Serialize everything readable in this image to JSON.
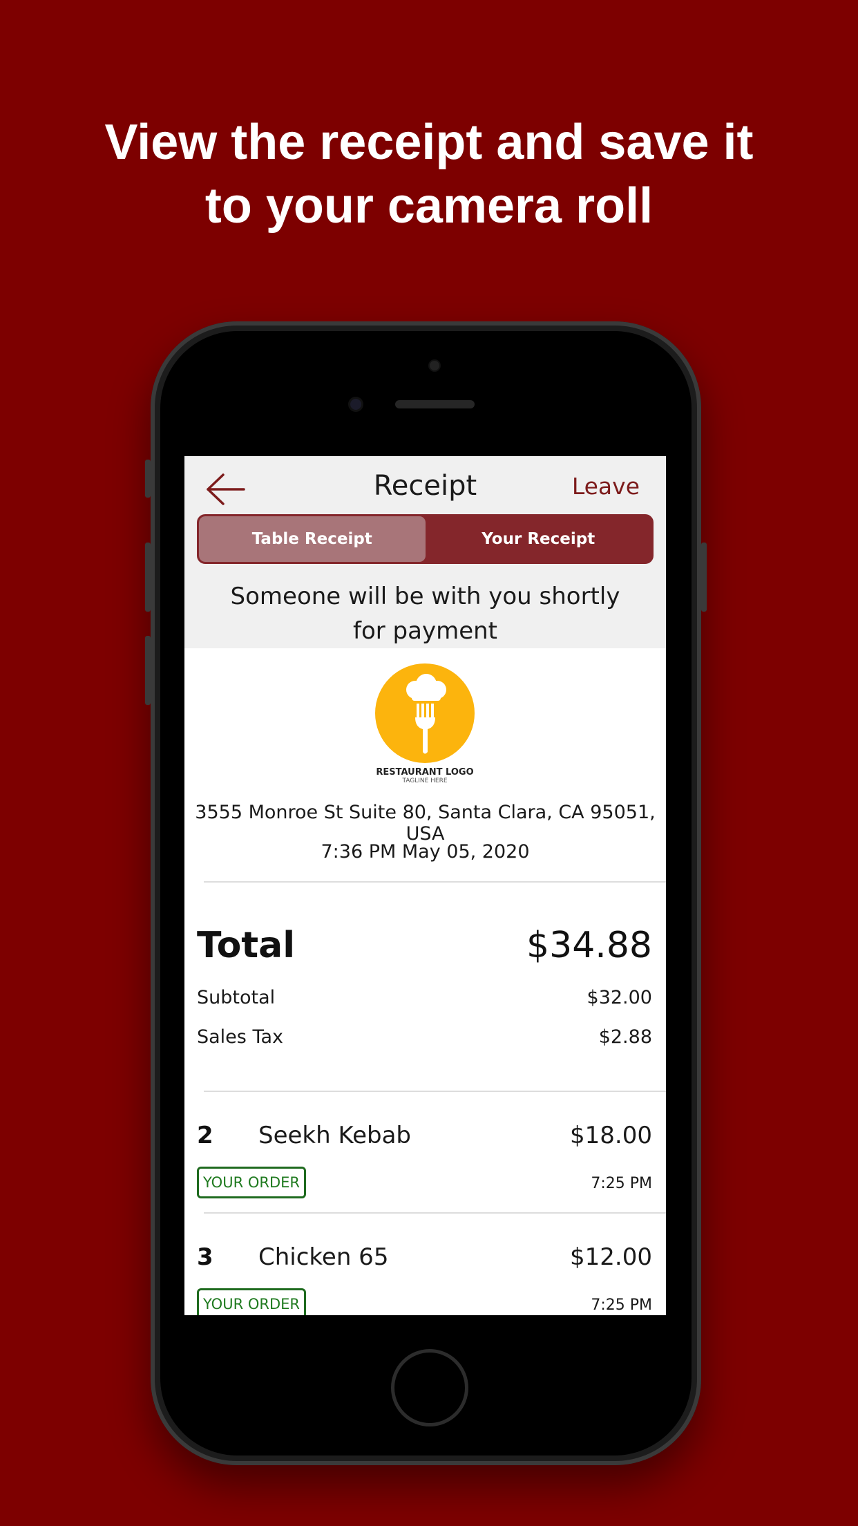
{
  "headline": {
    "line1": "View the receipt and save it",
    "line2": "to your camera roll"
  },
  "colors": {
    "background": "#7d0000",
    "accent": "#7d1c1c",
    "segment_bg": "#84262b",
    "badge_green": "#1f7a1f",
    "logo_orange": "#fcb40d"
  },
  "nav": {
    "back_icon": "arrow-left-icon",
    "title": "Receipt",
    "leave_label": "Leave"
  },
  "tabs": {
    "table_receipt": "Table Receipt",
    "your_receipt": "Your Receipt",
    "active": "table_receipt"
  },
  "notice": {
    "line1": "Someone will be with you shortly",
    "line2": "for payment"
  },
  "restaurant": {
    "logo_icon": "chef-hat-fork-icon",
    "logo_text": "RESTAURANT LOGO",
    "logo_tagline": "TAGLINE HERE",
    "address": "3555 Monroe St Suite 80, Santa Clara, CA 95051, USA",
    "datetime": "7:36 PM May 05, 2020"
  },
  "summary": {
    "total_label": "Total",
    "total_value": "$34.88",
    "subtotal_label": "Subtotal",
    "subtotal_value": "$32.00",
    "tax_label": "Sales Tax",
    "tax_value": "$2.88"
  },
  "items": [
    {
      "qty": "2",
      "name": "Seekh Kebab",
      "price": "$18.00",
      "badge": "YOUR ORDER",
      "time": "7:25 PM"
    },
    {
      "qty": "3",
      "name": "Chicken 65",
      "price": "$12.00",
      "badge": "YOUR ORDER",
      "time": "7:25 PM"
    }
  ]
}
